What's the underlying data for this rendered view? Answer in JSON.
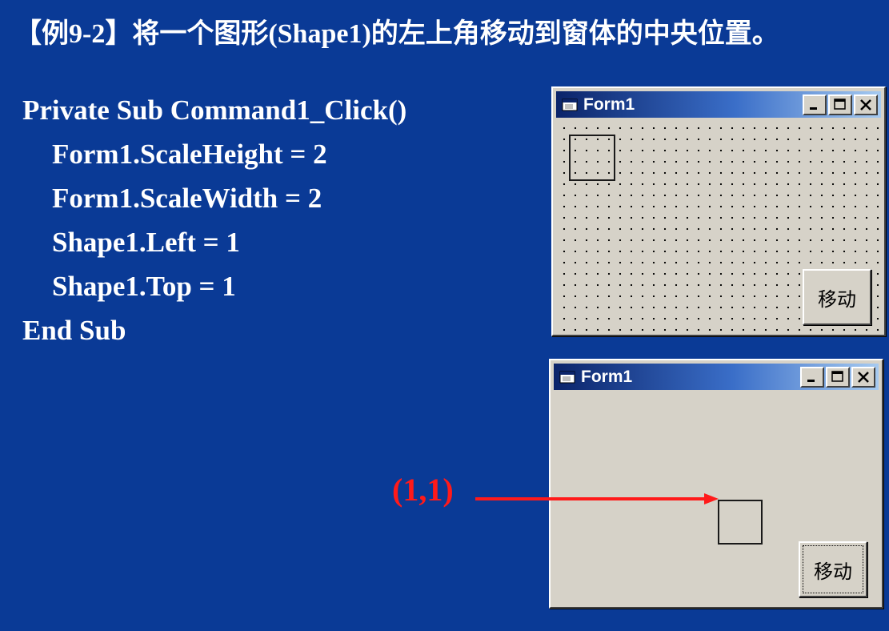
{
  "title": "【例9-2】将一个图形(Shape1)的左上角移动到窗体的中央位置。",
  "code_lines": [
    "Private Sub Command1_Click()",
    "Form1.ScaleHeight = 2",
    "Form1.ScaleWidth = 2",
    "Shape1.Left = 1",
    "Shape1.Top = 1",
    "End Sub"
  ],
  "window_before": {
    "title": "Form1",
    "button_label": "移动",
    "icon": "form-window-icon",
    "controls": [
      "minimize-icon",
      "maximize-icon",
      "close-icon"
    ]
  },
  "window_after": {
    "title": "Form1",
    "button_label": "移动",
    "icon": "form-window-icon",
    "controls": [
      "minimize-icon",
      "maximize-icon",
      "close-icon"
    ]
  },
  "annotation": {
    "label": "(1,1)",
    "color": "#ff1a1a"
  },
  "colors": {
    "background": "#0a3a96",
    "window_face": "#d6d2c8",
    "titlebar_start": "#0b246a",
    "titlebar_end": "#a6caf0"
  }
}
